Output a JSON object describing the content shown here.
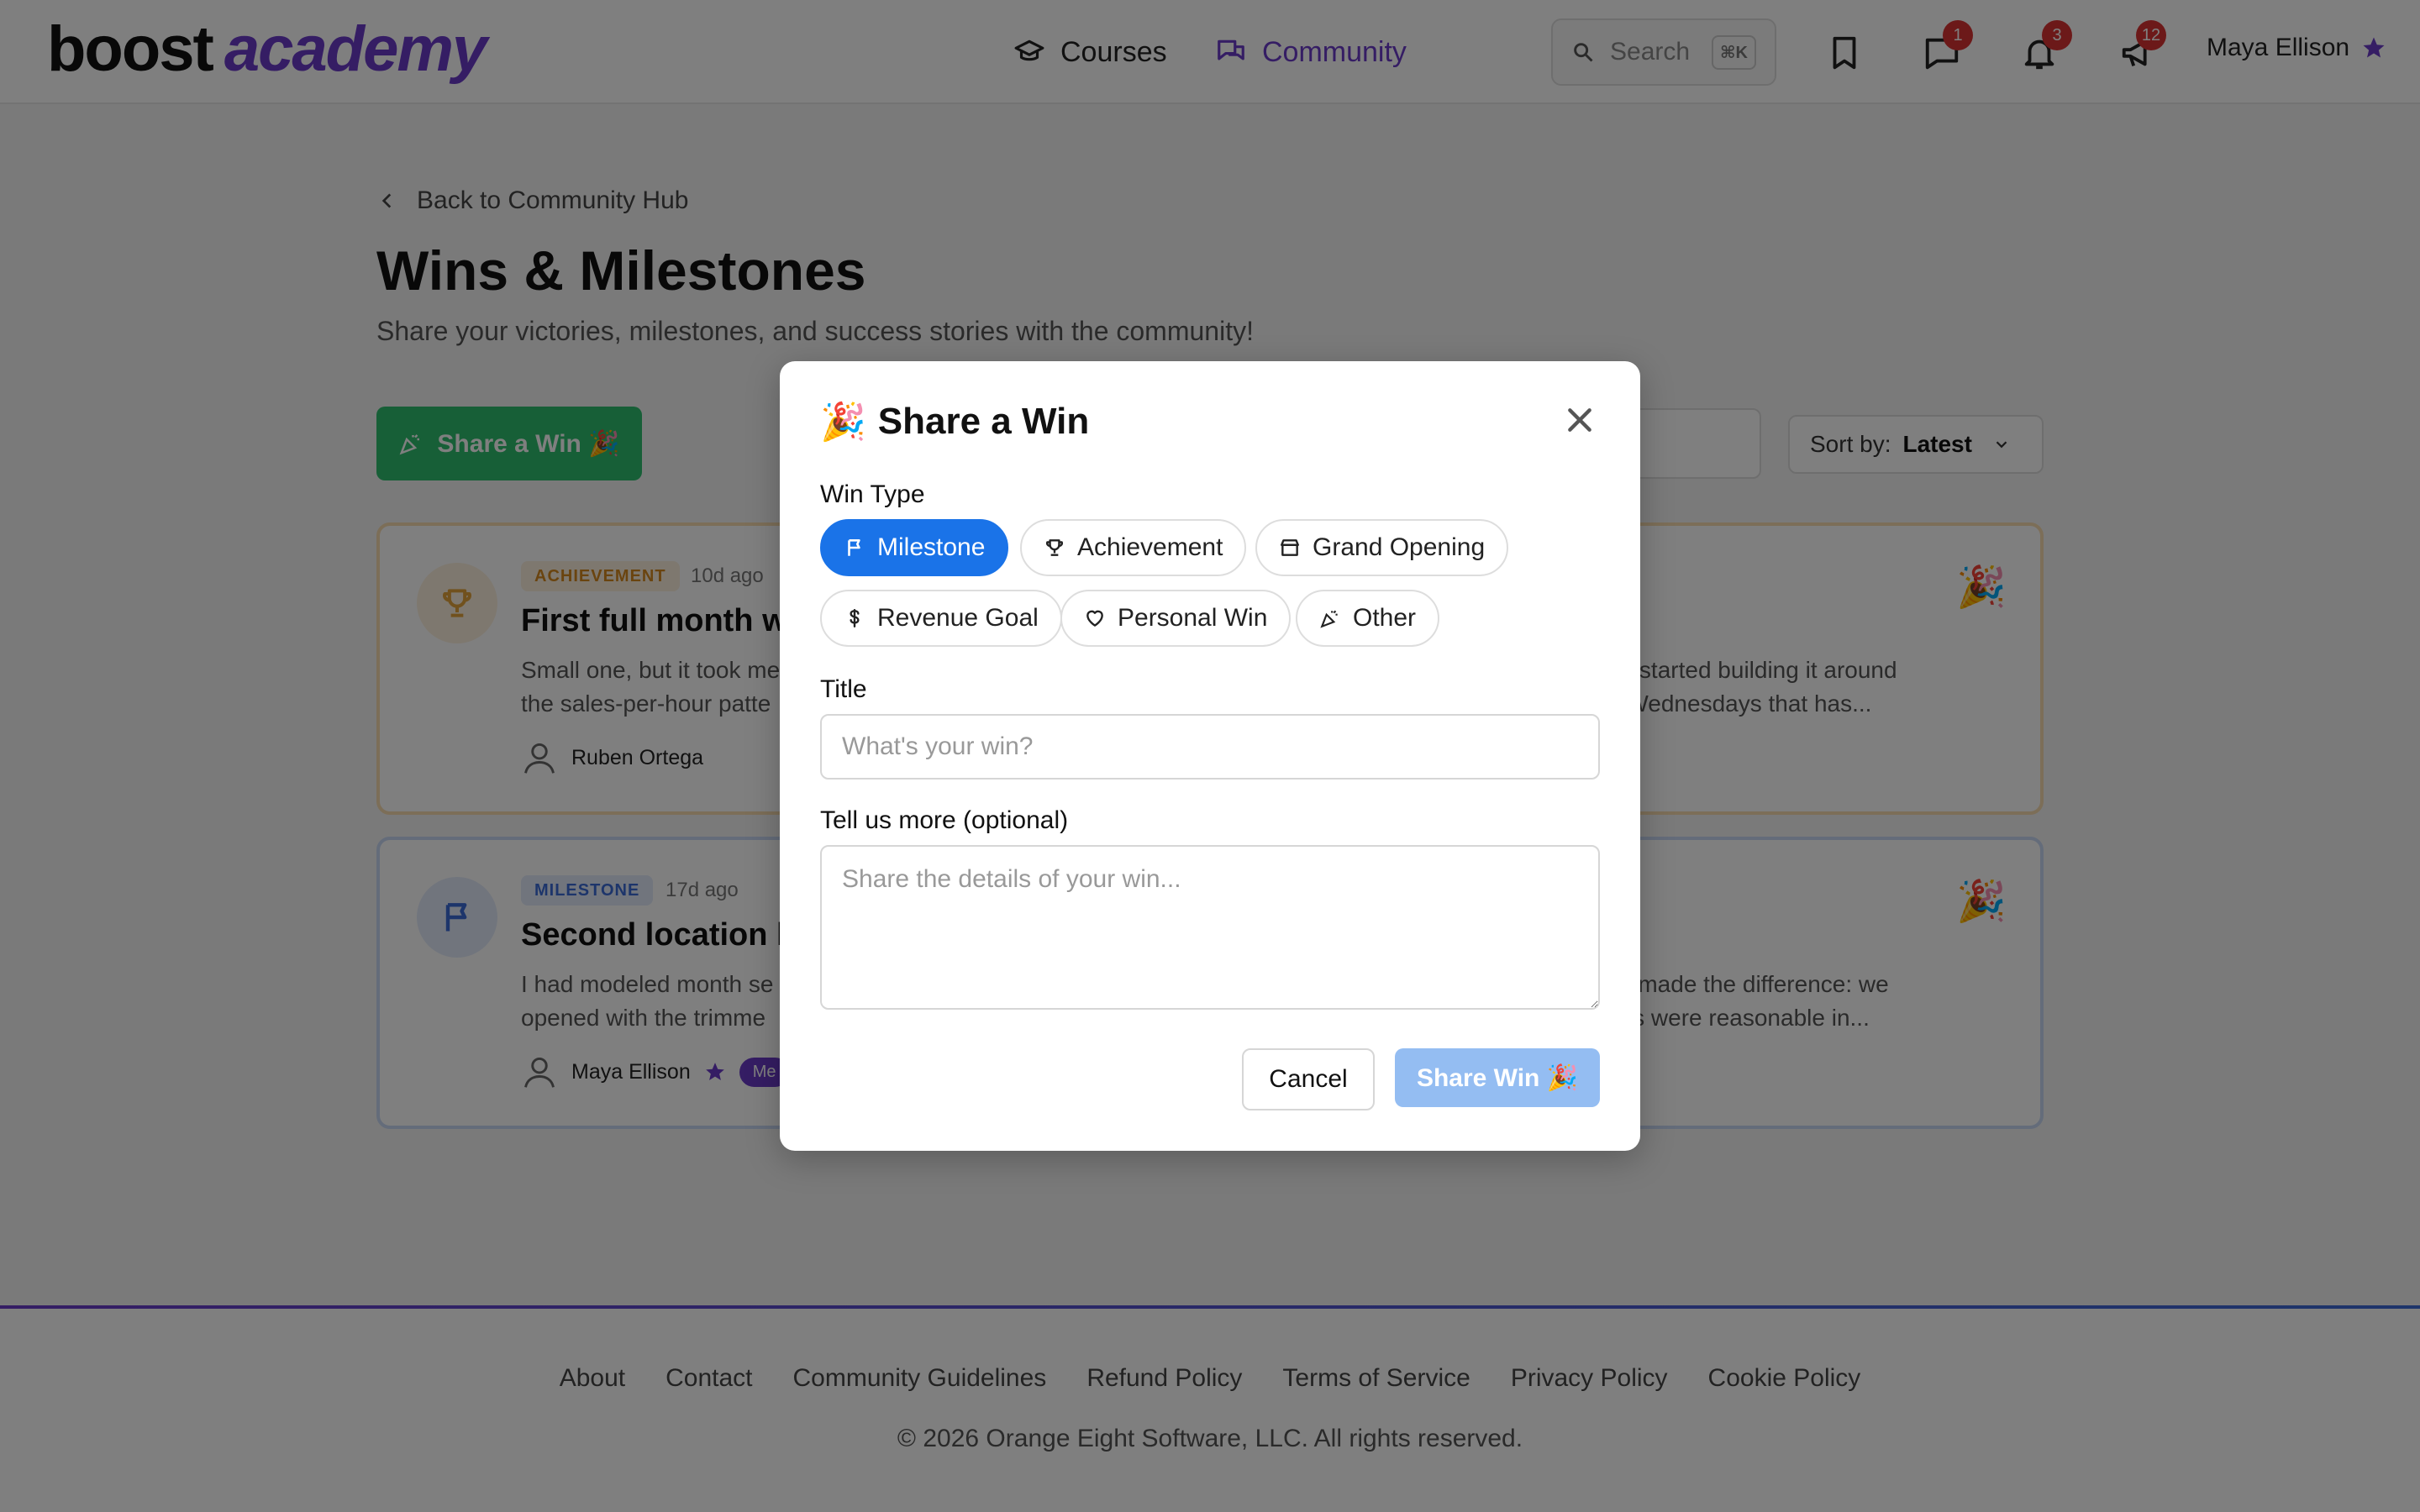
{
  "header": {
    "logo_part1": "boost",
    "logo_part2": "academy",
    "nav": [
      {
        "label": "Courses",
        "icon": "graduation-cap-icon",
        "active": false
      },
      {
        "label": "Community",
        "icon": "chat-bubbles-icon",
        "active": true
      }
    ],
    "search": {
      "label": "Search",
      "shortcut": "⌘K"
    },
    "badges": {
      "messages": "1",
      "notifications": "3",
      "announcements": "12"
    },
    "user_name": "Maya Ellison"
  },
  "page": {
    "back_label": "Back to Community Hub",
    "title": "Wins & Milestones",
    "subtitle": "Share your victories, milestones, and success stories with the community!",
    "share_button": "Share a Win 🎉",
    "sort_label": "Sort by:",
    "sort_value": "Latest"
  },
  "cards": [
    {
      "tag": "ACHIEVEMENT",
      "ago": "10d ago",
      "title": "First full month wi",
      "body_left": "Small one, but it took me",
      "body_left2": "the sales-per-hour patte",
      "body_right": "nd started building it around",
      "body_right2": "d Wednesdays that has...",
      "author": "Ruben Ortega",
      "icon": "trophy-icon",
      "accent": "#e2a23b"
    },
    {
      "tag": "MILESTONE",
      "ago": "17d ago",
      "title": "Second location h",
      "body_left": "I had modeled month se",
      "body_left2": "opened with the trimme",
      "body_right": "nk made the difference: we",
      "body_right2": "nes were reasonable in...",
      "author": "Maya Ellison",
      "author_badge": "Me",
      "icon": "flag-icon",
      "accent": "#3b6ad6"
    }
  ],
  "footer": {
    "links": [
      "About",
      "Contact",
      "Community Guidelines",
      "Refund Policy",
      "Terms of Service",
      "Privacy Policy",
      "Cookie Policy"
    ],
    "copyright": "© 2026 Orange Eight Software, LLC. All rights reserved."
  },
  "modal": {
    "emoji": "🎉",
    "title": "Share a Win",
    "win_type_label": "Win Type",
    "types": [
      {
        "label": "Milestone",
        "icon": "flag-icon",
        "selected": true
      },
      {
        "label": "Achievement",
        "icon": "trophy-icon",
        "selected": false
      },
      {
        "label": "Grand Opening",
        "icon": "storefront-icon",
        "selected": false
      },
      {
        "label": "Revenue Goal",
        "icon": "dollar-icon",
        "selected": false
      },
      {
        "label": "Personal Win",
        "icon": "heart-icon",
        "selected": false
      },
      {
        "label": "Other",
        "icon": "party-popper-icon",
        "selected": false
      }
    ],
    "title_label": "Title",
    "title_placeholder": "What's your win?",
    "details_label": "Tell us more (optional)",
    "details_placeholder": "Share the details of your win...",
    "cancel_label": "Cancel",
    "submit_label": "Share Win 🎉"
  },
  "colors": {
    "brand_purple": "#6a3bc9",
    "primary_blue": "#1a73e8",
    "success_green": "#2fbf6f",
    "badge_red": "#d93333"
  }
}
